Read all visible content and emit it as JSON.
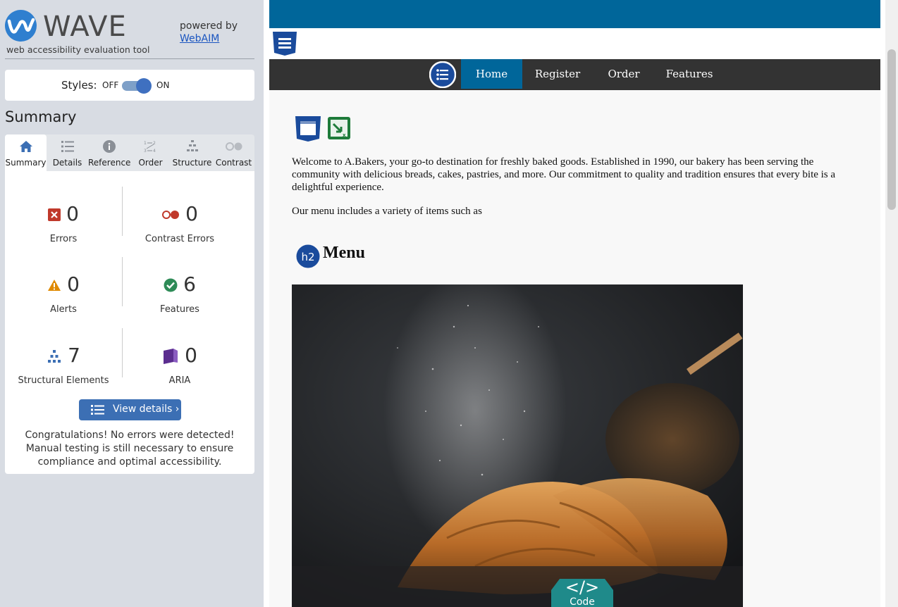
{
  "wave": {
    "logo_text": "WAVE",
    "subtitle": "web accessibility evaluation tool",
    "powered_by": "powered by",
    "webaim_link": "WebAIM",
    "styles_label": "Styles:",
    "toggle_off": "OFF",
    "toggle_on": "ON",
    "summary_title": "Summary",
    "tabs": [
      {
        "label": "Summary",
        "icon": "home-icon",
        "active": true
      },
      {
        "label": "Details",
        "icon": "list-icon"
      },
      {
        "label": "Reference",
        "icon": "info-icon"
      },
      {
        "label": "Order",
        "icon": "order-icon"
      },
      {
        "label": "Structure",
        "icon": "structure-icon"
      },
      {
        "label": "Contrast",
        "icon": "contrast-toggle-icon"
      }
    ],
    "stats": {
      "errors": {
        "count": "0",
        "label": "Errors",
        "icon": "error-icon",
        "color": "#c0392b"
      },
      "contrast_errors": {
        "count": "0",
        "label": "Contrast Errors",
        "icon": "contrast-error-icon",
        "color": "#c0392b"
      },
      "alerts": {
        "count": "0",
        "label": "Alerts",
        "icon": "alert-icon",
        "color": "#e08a00"
      },
      "features": {
        "count": "6",
        "label": "Features",
        "icon": "feature-check-icon",
        "color": "#2e8b57"
      },
      "structural": {
        "count": "7",
        "label": "Structural Elements",
        "icon": "structure-icon",
        "color": "#3c6fb4"
      },
      "aria": {
        "count": "0",
        "label": "ARIA",
        "icon": "aria-icon",
        "color": "#5b2d8f"
      }
    },
    "view_details": "View details ›",
    "congrats": "Congratulations! No errors were detected! Manual testing is still necessary to ensure compliance and optimal accessibility."
  },
  "site": {
    "nav": [
      "Home",
      "Register",
      "Order",
      "Features"
    ],
    "active_nav": "Home",
    "welcome": "Welcome to A.Bakers, your go-to destination for freshly baked goods. Established in 1990, our bakery has been serving the community with delicious breads, cakes, pastries, and more. Our commitment to quality and tradition ensures that every bite is a delightful experience.",
    "menu_intro": "Our menu includes a variety of items such as",
    "heading_badge": "h2",
    "heading": "Menu",
    "code_label": "Code",
    "colors": {
      "header": "#00669a",
      "nav": "#333333",
      "content_bg": "#f8f8f8"
    }
  }
}
